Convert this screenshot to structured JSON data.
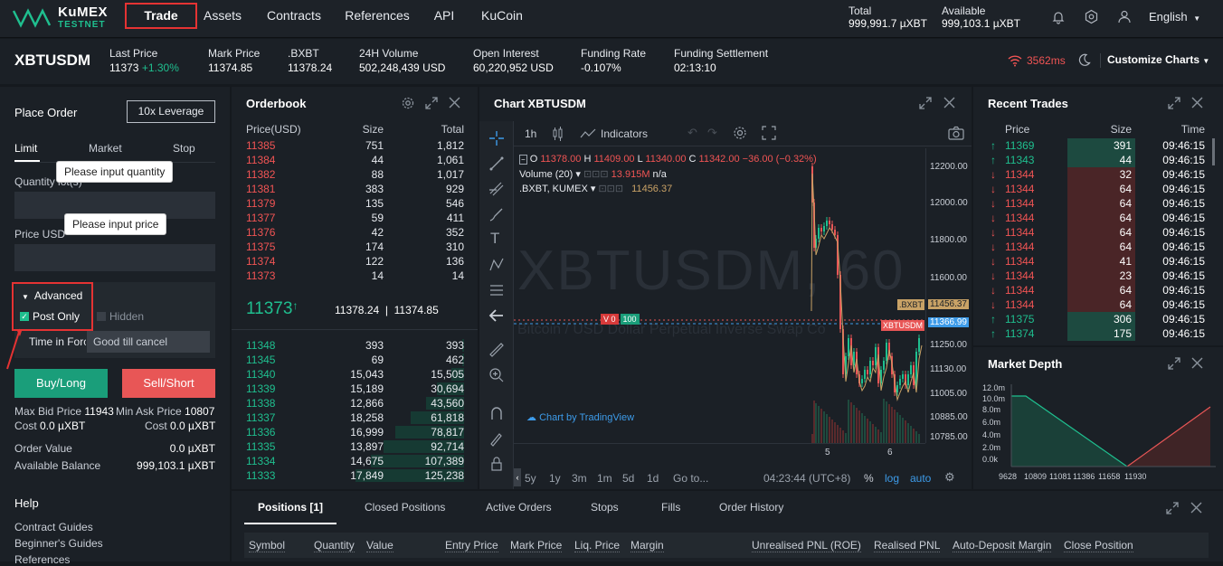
{
  "nav": {
    "logo_name": "KuMEX",
    "logo_sub": "TESTNET",
    "items": [
      "Trade",
      "Assets",
      "Contracts",
      "References",
      "API",
      "KuCoin"
    ],
    "total_label": "Total",
    "total_value": "999,991.7 µXBT",
    "available_label": "Available",
    "available_value": "999,103.1 µXBT",
    "language": "English"
  },
  "ticker": {
    "symbol": "XBTUSDM",
    "stats": [
      {
        "k": "Last Price",
        "v": "11373",
        "extra": "+1.30%"
      },
      {
        "k": "Mark Price",
        "v": "11374.85"
      },
      {
        "k": ".BXBT",
        "v": "11378.24"
      },
      {
        "k": "24H Volume",
        "v": "502,248,439 USD"
      },
      {
        "k": "Open Interest",
        "v": "60,220,952 USD"
      },
      {
        "k": "Funding Rate",
        "v": "-0.107%"
      },
      {
        "k": "Funding Settlement",
        "v": "02:13:10"
      }
    ],
    "latency": "3562ms",
    "customize": "Customize Charts"
  },
  "order": {
    "title": "Place Order",
    "leverage": "10x  Leverage",
    "tabs": [
      "Limit",
      "Market",
      "Stop"
    ],
    "qty_tooltip": "Please input quantity",
    "qty_label": "Quantity lot(s)",
    "price_tooltip": "Please input price",
    "price_label": "Price USD",
    "advanced": "Advanced",
    "post_only": "Post Only",
    "hidden": "Hidden",
    "tif_label": "Time in Force",
    "tif_value": "Good till cancel",
    "buy": "Buy/Long",
    "sell": "Sell/Short",
    "max_bid_label": "Max Bid Price",
    "max_bid": "11943",
    "min_ask_label": "Min Ask Price",
    "min_ask": "10807",
    "cost_label": "Cost",
    "cost_buy": "0.0 µXBT",
    "cost_sell": "0.0 µXBT",
    "order_value_label": "Order Value",
    "order_value": "0.0 µXBT",
    "avail_label": "Available Balance",
    "avail_value": "999,103.1 µXBT",
    "help": "Help",
    "help_links": [
      "Contract Guides",
      "Beginner's Guides",
      "References"
    ]
  },
  "orderbook": {
    "title": "Orderbook",
    "headers": [
      "Price(USD)",
      "Size",
      "Total"
    ],
    "asks": [
      [
        "11385",
        "751",
        "1,812"
      ],
      [
        "11384",
        "44",
        "1,061"
      ],
      [
        "11382",
        "88",
        "1,017"
      ],
      [
        "11381",
        "383",
        "929"
      ],
      [
        "11379",
        "135",
        "546"
      ],
      [
        "11377",
        "59",
        "411"
      ],
      [
        "11376",
        "42",
        "352"
      ],
      [
        "11375",
        "174",
        "310"
      ],
      [
        "11374",
        "122",
        "136"
      ],
      [
        "11373",
        "14",
        "14"
      ]
    ],
    "last": "11373",
    "index_mark": "11378.24  |  11374.85",
    "bids": [
      [
        "11348",
        "393",
        "393"
      ],
      [
        "11345",
        "69",
        "462"
      ],
      [
        "11340",
        "15,043",
        "15,505"
      ],
      [
        "11339",
        "15,189",
        "30,694"
      ],
      [
        "11338",
        "12,866",
        "43,560"
      ],
      [
        "11337",
        "18,258",
        "61,818"
      ],
      [
        "11336",
        "16,999",
        "78,817"
      ],
      [
        "11335",
        "13,897",
        "92,714"
      ],
      [
        "11334",
        "14,675",
        "107,389"
      ],
      [
        "11333",
        "17,849",
        "125,238"
      ]
    ],
    "bid_depth": [
      0.003,
      0.004,
      0.12,
      0.25,
      0.35,
      0.49,
      0.63,
      0.74,
      0.86,
      1.0
    ]
  },
  "chart": {
    "title": "Chart XBTUSDM",
    "interval": "1h",
    "indicators": "Indicators",
    "ohlc_o": "11378.00",
    "ohlc_h": "11409.00",
    "ohlc_l": "11340.00",
    "ohlc_c": "11342.00",
    "change": "−36.00 (−0.32%)",
    "volume_label": "Volume (20)",
    "volume_value": "13.915M",
    "volume_na": "n/a",
    "compare_label": ".BXBT, KUMEX",
    "compare_value": "11456.37",
    "watermark": "XBTUSDM, 60",
    "watermark_sub": "Bitcoin / USD Dollar Perpetual Inverse Swap Co",
    "credit": "Chart by TradingView",
    "y_ticks": [
      "12200.00",
      "12000.00",
      "11800.00",
      "11600.00",
      "11456.37",
      "11366.99",
      "11250.00",
      "11130.00",
      "11005.00",
      "10885.00",
      "10785.00"
    ],
    "bxbt_tag": ".BXBT",
    "xbt_tag": "XBTUSDM",
    "x_ticks": [
      "5",
      "6"
    ],
    "ranges": [
      "5y",
      "1y",
      "3m",
      "1m",
      "5d",
      "1d",
      "Go to..."
    ],
    "time": "04:23:44 (UTC+8)",
    "pct": "%",
    "log": "log",
    "auto": "auto",
    "v_badge": "V 0",
    "v_badge2": "100"
  },
  "trades": {
    "title": "Recent Trades",
    "headers": [
      "Price",
      "Size",
      "Time"
    ],
    "rows": [
      [
        "up",
        "11369",
        "391",
        "09:46:15"
      ],
      [
        "up",
        "11343",
        "44",
        "09:46:15"
      ],
      [
        "down",
        "11344",
        "32",
        "09:46:15"
      ],
      [
        "down",
        "11344",
        "64",
        "09:46:15"
      ],
      [
        "down",
        "11344",
        "64",
        "09:46:15"
      ],
      [
        "down",
        "11344",
        "64",
        "09:46:15"
      ],
      [
        "down",
        "11344",
        "64",
        "09:46:15"
      ],
      [
        "down",
        "11344",
        "64",
        "09:46:15"
      ],
      [
        "down",
        "11344",
        "41",
        "09:46:15"
      ],
      [
        "down",
        "11344",
        "23",
        "09:46:15"
      ],
      [
        "down",
        "11344",
        "64",
        "09:46:15"
      ],
      [
        "down",
        "11344",
        "64",
        "09:46:15"
      ],
      [
        "up",
        "11375",
        "306",
        "09:46:15"
      ],
      [
        "up",
        "11374",
        "175",
        "09:46:15"
      ]
    ]
  },
  "depth": {
    "title": "Market Depth",
    "y_ticks": [
      "12.0m",
      "10.0m",
      "8.0m",
      "6.0m",
      "4.0m",
      "2.0m",
      "0.0k"
    ],
    "x_ticks": [
      "9628",
      "10809",
      "11081",
      "11386",
      "11658",
      "11930"
    ]
  },
  "positions": {
    "tabs": [
      "Positions [1]",
      "Closed Positions",
      "Active Orders",
      "Stops",
      "Fills",
      "Order History"
    ],
    "columns": [
      "Symbol",
      "Quantity",
      "Value",
      "Entry Price",
      "Mark Price",
      "Liq. Price",
      "Margin",
      "Unrealised PNL (ROE)",
      "Realised PNL",
      "Auto-Deposit Margin",
      "Close Position"
    ]
  },
  "colors": {
    "green": "#1fbf8f",
    "red": "#f15454",
    "highlight": "#e53333"
  }
}
